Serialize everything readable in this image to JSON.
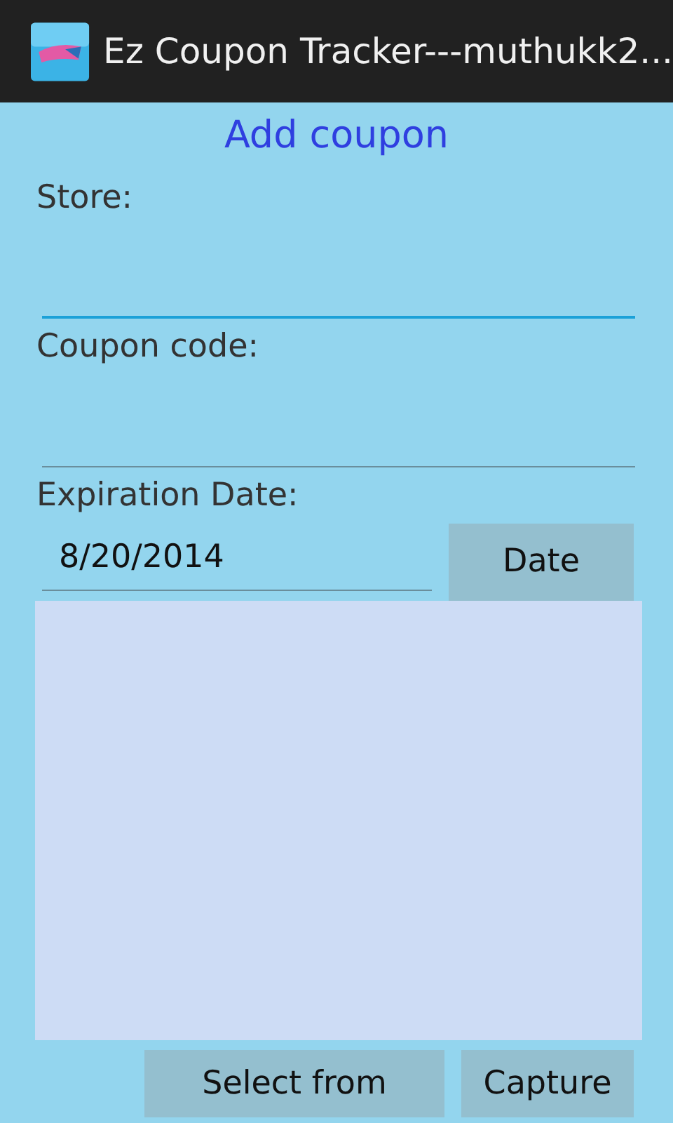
{
  "title_bar": {
    "title": "Ez Coupon Tracker---muthukk2..."
  },
  "heading": "Add coupon",
  "fields": [
    {
      "label": "Store:",
      "focused": true
    },
    {
      "label": "Coupon code:",
      "focused": false
    }
  ],
  "expiration": {
    "label": "Expiration Date:",
    "value": "8/20/2014",
    "focused": false,
    "button": "Date"
  },
  "image_area": {
    "kind": "empty"
  },
  "buttons": [
    "Select from",
    "Capture"
  ]
}
